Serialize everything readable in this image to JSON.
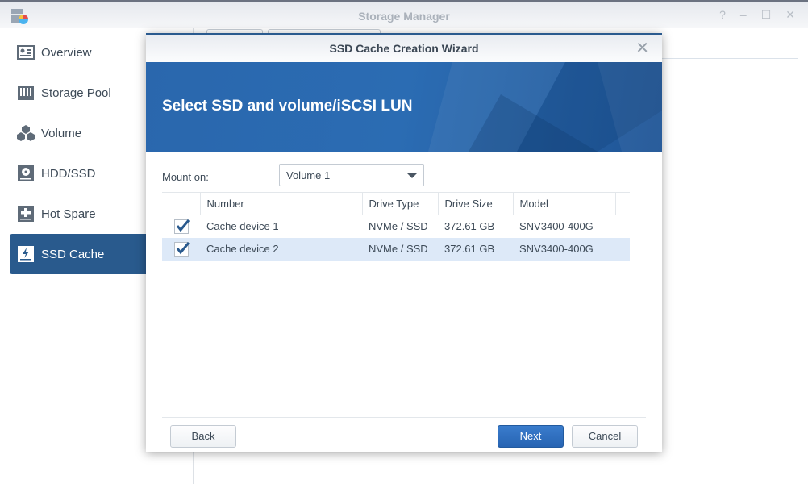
{
  "window": {
    "title": "Storage Manager",
    "controls": [
      "?",
      "–",
      "☐",
      "✕"
    ]
  },
  "sidebar": {
    "items": [
      {
        "label": "Overview",
        "icon": "overview-icon"
      },
      {
        "label": "Storage Pool",
        "icon": "storage-pool-icon"
      },
      {
        "label": "Volume",
        "icon": "volume-icon"
      },
      {
        "label": "HDD/SSD",
        "icon": "hdd-icon"
      },
      {
        "label": "Hot Spare",
        "icon": "hot-spare-icon"
      },
      {
        "label": "SSD Cache",
        "icon": "ssd-cache-icon",
        "active": true
      }
    ]
  },
  "dialog": {
    "title": "SSD Cache Creation Wizard",
    "close": "✕",
    "heading": "Select SSD and volume/iSCSI LUN",
    "mount_label": "Mount on:",
    "mount_value": "Volume 1",
    "columns": [
      "Number",
      "Drive Type",
      "Drive Size",
      "Model"
    ],
    "rows": [
      {
        "checked": true,
        "number": "Cache device 1",
        "type": "NVMe / SSD",
        "size": "372.61 GB",
        "model": "SNV3400-400G"
      },
      {
        "checked": true,
        "number": "Cache device 2",
        "type": "NVMe / SSD",
        "size": "372.61 GB",
        "model": "SNV3400-400G"
      }
    ],
    "back": "Back",
    "next": "Next",
    "cancel": "Cancel"
  },
  "colors": {
    "accent": "#295a8d",
    "primary": "#2764b3",
    "selected_row": "#dde9f8"
  }
}
